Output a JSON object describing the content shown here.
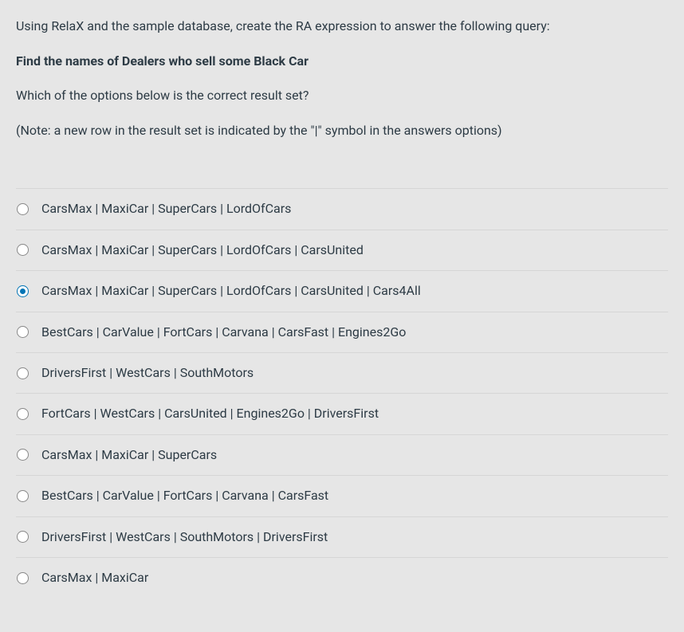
{
  "question": {
    "intro": "Using RelaX and the sample database, create the RA expression to answer the following query:",
    "prompt": "Find the names of Dealers who sell some Black Car",
    "followup": "Which of the options below is the correct result set?",
    "note": "(Note: a new row in the result set is indicated by the \"|\" symbol in the answers options)"
  },
  "options": [
    {
      "label": "CarsMax | MaxiCar | SuperCars | LordOfCars",
      "selected": false
    },
    {
      "label": "CarsMax | MaxiCar | SuperCars | LordOfCars | CarsUnited",
      "selected": false
    },
    {
      "label": "CarsMax | MaxiCar | SuperCars | LordOfCars | CarsUnited | Cars4All",
      "selected": true
    },
    {
      "label": "BestCars | CarValue | FortCars | Carvana | CarsFast | Engines2Go",
      "selected": false
    },
    {
      "label": "DriversFirst | WestCars | SouthMotors",
      "selected": false
    },
    {
      "label": "FortCars | WestCars | CarsUnited | Engines2Go | DriversFirst",
      "selected": false
    },
    {
      "label": "CarsMax | MaxiCar | SuperCars",
      "selected": false
    },
    {
      "label": "BestCars | CarValue | FortCars | Carvana | CarsFast",
      "selected": false
    },
    {
      "label": "DriversFirst | WestCars | SouthMotors | DriversFirst",
      "selected": false
    },
    {
      "label": "CarsMax | MaxiCar",
      "selected": false
    }
  ]
}
